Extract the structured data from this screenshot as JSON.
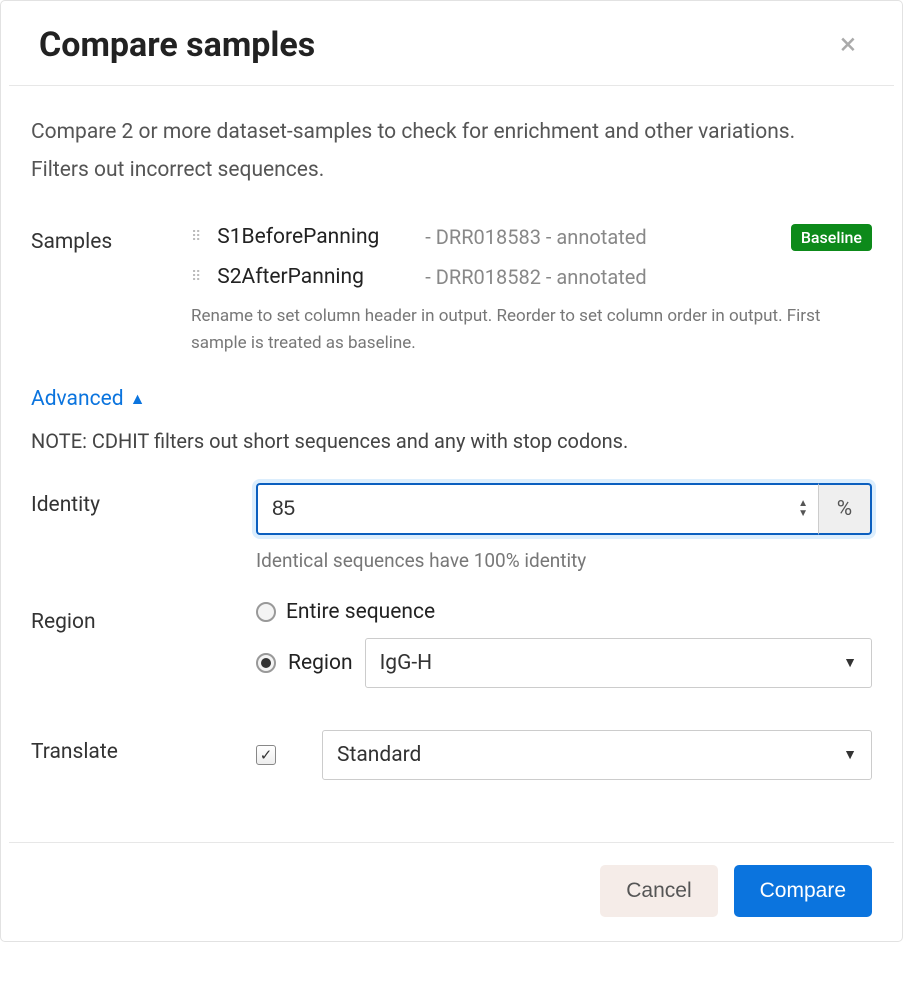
{
  "dialog": {
    "title": "Compare samples",
    "intro_line1": "Compare 2 or more dataset-samples to check for enrichment and other variations.",
    "intro_line2": "Filters out incorrect sequences.",
    "samples": {
      "label": "Samples",
      "items": [
        {
          "name": "S1BeforePanning",
          "suffix": "- DRR018583 - annotated",
          "badge": "Baseline"
        },
        {
          "name": "S2AfterPanning",
          "suffix": "- DRR018582 - annotated",
          "badge": ""
        }
      ],
      "hint": "Rename to set column header in output. Reorder to set column order in output. First sample is treated as baseline."
    },
    "advanced": {
      "toggle_label": "Advanced",
      "note": "NOTE: CDHIT filters out short sequences and any with stop codons."
    },
    "identity": {
      "label": "Identity",
      "value": "85",
      "unit": "%",
      "hint": "Identical sequences have 100% identity"
    },
    "region": {
      "label": "Region",
      "option_entire": "Entire sequence",
      "option_region": "Region",
      "selected": "region",
      "select_value": "IgG-H"
    },
    "translate": {
      "label": "Translate",
      "checked": true,
      "select_value": "Standard"
    },
    "buttons": {
      "cancel": "Cancel",
      "compare": "Compare"
    }
  }
}
